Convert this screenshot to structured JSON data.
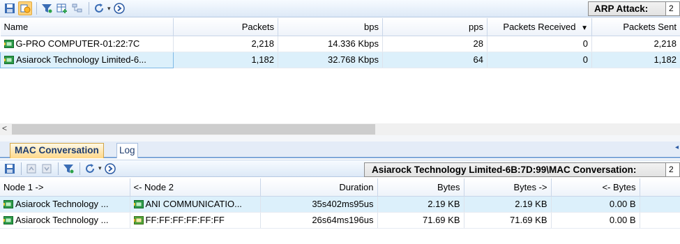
{
  "top_toolbar": {
    "icons": [
      "save-icon",
      "node-view-icon",
      "filter-icon",
      "add-column-icon",
      "tree-icon",
      "refresh-icon",
      "dropdown-arrow-icon",
      "go-icon"
    ],
    "label": "ARP Attack:",
    "value": "2"
  },
  "top_table": {
    "columns": [
      "Name",
      "Packets",
      "bps",
      "pps",
      "Packets Received",
      "Packets Sent"
    ],
    "sort_indicator": "▼",
    "rows": [
      {
        "name": "G-PRO COMPUTER-01:22:7C",
        "packets": "2,218",
        "bps": "14.336 Kbps",
        "pps": "28",
        "received": "0",
        "sent": "2,218"
      },
      {
        "name": "Asiarock Technology Limited-6...",
        "packets": "1,182",
        "bps": "32.768 Kbps",
        "pps": "64",
        "received": "0",
        "sent": "1,182"
      }
    ]
  },
  "scrollbar": {
    "left_arrow": "<"
  },
  "tabs": {
    "active": "MAC Conversation",
    "inactive": "Log",
    "scroll_arrow": "◂"
  },
  "bottom_toolbar": {
    "icons": [
      "save-icon",
      "bookmark-prev-icon",
      "bookmark-next-icon",
      "filter-icon",
      "refresh-icon",
      "dropdown-arrow-icon",
      "go-icon"
    ],
    "label": "Asiarock Technology Limited-6B:7D:99\\MAC Conversation:",
    "value": "2"
  },
  "bottom_table": {
    "columns": [
      "Node 1 ->",
      "<- Node 2",
      "Duration",
      "Bytes",
      "Bytes ->",
      "<- Bytes"
    ],
    "rows": [
      {
        "node1": "Asiarock Technology ...",
        "node2": "ANI COMMUNICATIO...",
        "duration": "35s402ms95us",
        "bytes": "2.19 KB",
        "bytes_out": "2.19 KB",
        "bytes_in": "0.00 B"
      },
      {
        "node1": "Asiarock Technology ...",
        "node2": "FF:FF:FF:FF:FF:FF",
        "duration": "26s64ms196us",
        "bytes": "71.69 KB",
        "bytes_out": "71.69 KB",
        "bytes_in": "0.00 B"
      }
    ]
  },
  "colors": {
    "accent": "#2b5aa3",
    "selection": "#dcf0fb",
    "host_icon": "#1e8f2e"
  }
}
